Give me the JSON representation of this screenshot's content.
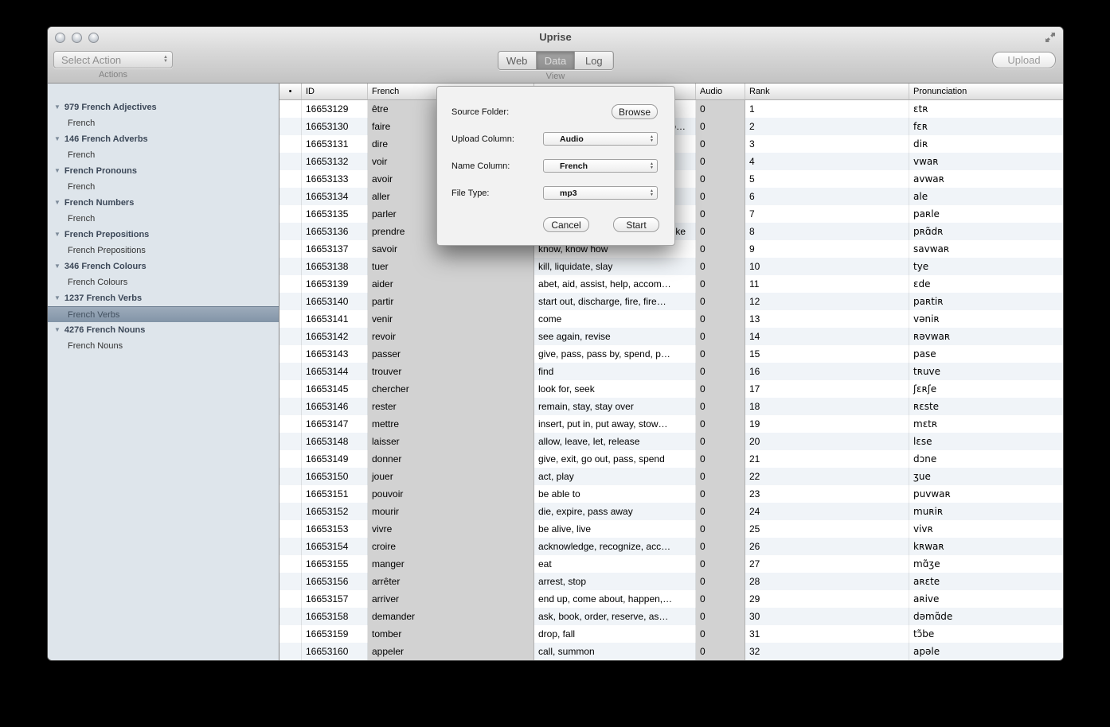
{
  "window": {
    "title": "Uprise"
  },
  "toolbar": {
    "action_select": {
      "value": "Select Action",
      "label": "Actions"
    },
    "view_segments": {
      "items": [
        "Web",
        "Data",
        "Log"
      ],
      "selected": "Data",
      "label": "View"
    },
    "upload_label": "Upload"
  },
  "sidebar": {
    "groups": [
      {
        "title": "979 French Adjectives",
        "items": [
          "French"
        ]
      },
      {
        "title": "146 French Adverbs",
        "items": [
          "French"
        ]
      },
      {
        "title": "French Pronouns",
        "items": [
          "French"
        ]
      },
      {
        "title": "French Numbers",
        "items": [
          "French"
        ]
      },
      {
        "title": "French Prepositions",
        "items": [
          "French Prepositions"
        ]
      },
      {
        "title": "346 French Colours",
        "items": [
          "French Colours"
        ]
      },
      {
        "title": "1237 French Verbs",
        "items": [
          "French Verbs"
        ],
        "selected": "French Verbs"
      },
      {
        "title": "4276 French Nouns",
        "items": [
          "French Nouns"
        ]
      }
    ]
  },
  "dialog": {
    "fields": [
      {
        "label": "Source Folder:",
        "type": "button",
        "value": "Browse"
      },
      {
        "label": "Upload Column:",
        "type": "select",
        "value": "Audio"
      },
      {
        "label": "Name Column:",
        "type": "select",
        "value": "French"
      },
      {
        "label": "File Type:",
        "type": "select",
        "value": "mp3"
      }
    ],
    "cancel_label": "Cancel",
    "start_label": "Start"
  },
  "table": {
    "columns": [
      "•",
      "ID",
      "French",
      "",
      "Audio",
      "Rank",
      "Pronunciation"
    ],
    "rows": [
      {
        "id": "16653129",
        "french": "être",
        "english": "",
        "audio": "0",
        "rank": "1",
        "pronunciation": "ɛtʀ"
      },
      {
        "id": "16653130",
        "french": "faire",
        "english": "o…",
        "english_partial": true,
        "audio": "0",
        "rank": "2",
        "pronunciation": "fɛʀ"
      },
      {
        "id": "16653131",
        "french": "dire",
        "english": "",
        "audio": "0",
        "rank": "3",
        "pronunciation": "diʀ"
      },
      {
        "id": "16653132",
        "french": "voir",
        "english": "",
        "audio": "0",
        "rank": "4",
        "pronunciation": "vwaʀ"
      },
      {
        "id": "16653133",
        "french": "avoir",
        "english": "",
        "audio": "0",
        "rank": "5",
        "pronunciation": "avwaʀ"
      },
      {
        "id": "16653134",
        "french": "aller",
        "english": "",
        "audio": "0",
        "rank": "6",
        "pronunciation": "ale"
      },
      {
        "id": "16653135",
        "french": "parler",
        "english": "",
        "audio": "0",
        "rank": "7",
        "pronunciation": "paʀle"
      },
      {
        "id": "16653136",
        "french": "prendre",
        "english": "ke",
        "english_partial": true,
        "audio": "0",
        "rank": "8",
        "pronunciation": "pʀɑ̃dʀ"
      },
      {
        "id": "16653137",
        "french": "savoir",
        "english": "know, know how",
        "audio": "0",
        "rank": "9",
        "pronunciation": "savwaʀ"
      },
      {
        "id": "16653138",
        "french": "tuer",
        "english": "kill, liquidate, slay",
        "audio": "0",
        "rank": "10",
        "pronunciation": "tye"
      },
      {
        "id": "16653139",
        "french": "aider",
        "english": "abet, aid, assist, help, accom…",
        "audio": "0",
        "rank": "11",
        "pronunciation": "ɛde"
      },
      {
        "id": "16653140",
        "french": "partir",
        "english": "start out, discharge, fire, fire…",
        "audio": "0",
        "rank": "12",
        "pronunciation": "paʀtiʀ"
      },
      {
        "id": "16653141",
        "french": "venir",
        "english": "come",
        "audio": "0",
        "rank": "13",
        "pronunciation": "vəniʀ"
      },
      {
        "id": "16653142",
        "french": "revoir",
        "english": "see again, revise",
        "audio": "0",
        "rank": "14",
        "pronunciation": "ʀəvwaʀ"
      },
      {
        "id": "16653143",
        "french": "passer",
        "english": "give, pass, pass by, spend, p…",
        "audio": "0",
        "rank": "15",
        "pronunciation": "pase"
      },
      {
        "id": "16653144",
        "french": "trouver",
        "english": "find",
        "audio": "0",
        "rank": "16",
        "pronunciation": "tʀuve"
      },
      {
        "id": "16653145",
        "french": "chercher",
        "english": "look for, seek",
        "audio": "0",
        "rank": "17",
        "pronunciation": "ʃɛʀʃe"
      },
      {
        "id": "16653146",
        "french": "rester",
        "english": "remain, stay, stay over",
        "audio": "0",
        "rank": "18",
        "pronunciation": "ʀɛste"
      },
      {
        "id": "16653147",
        "french": "mettre",
        "english": "insert, put in, put away, stow…",
        "audio": "0",
        "rank": "19",
        "pronunciation": "mɛtʀ"
      },
      {
        "id": "16653148",
        "french": "laisser",
        "english": "allow, leave, let, release",
        "audio": "0",
        "rank": "20",
        "pronunciation": "lɛse"
      },
      {
        "id": "16653149",
        "french": "donner",
        "english": "give, exit, go out, pass, spend",
        "audio": "0",
        "rank": "21",
        "pronunciation": "dɔne"
      },
      {
        "id": "16653150",
        "french": "jouer",
        "english": "act, play",
        "audio": "0",
        "rank": "22",
        "pronunciation": "ʒue"
      },
      {
        "id": "16653151",
        "french": "pouvoir",
        "english": "be able to",
        "audio": "0",
        "rank": "23",
        "pronunciation": "puvwaʀ"
      },
      {
        "id": "16653152",
        "french": "mourir",
        "english": "die, expire, pass away",
        "audio": "0",
        "rank": "24",
        "pronunciation": "muʀiʀ"
      },
      {
        "id": "16653153",
        "french": "vivre",
        "english": "be alive, live",
        "audio": "0",
        "rank": "25",
        "pronunciation": "vivʀ"
      },
      {
        "id": "16653154",
        "french": "croire",
        "english": "acknowledge, recognize, acc…",
        "audio": "0",
        "rank": "26",
        "pronunciation": "kʀwaʀ"
      },
      {
        "id": "16653155",
        "french": "manger",
        "english": "eat",
        "audio": "0",
        "rank": "27",
        "pronunciation": "mɑ̃ʒe"
      },
      {
        "id": "16653156",
        "french": "arrêter",
        "english": "arrest, stop",
        "audio": "0",
        "rank": "28",
        "pronunciation": "aʀɛte"
      },
      {
        "id": "16653157",
        "french": "arriver",
        "english": "end up, come about, happen,…",
        "audio": "0",
        "rank": "29",
        "pronunciation": "aʀive"
      },
      {
        "id": "16653158",
        "french": "demander",
        "english": "ask, book, order, reserve, as…",
        "audio": "0",
        "rank": "30",
        "pronunciation": "dəmɑ̃de"
      },
      {
        "id": "16653159",
        "french": "tomber",
        "english": "drop, fall",
        "audio": "0",
        "rank": "31",
        "pronunciation": "tɔ̃be"
      },
      {
        "id": "16653160",
        "french": "appeler",
        "english": "call, summon",
        "audio": "0",
        "rank": "32",
        "pronunciation": "apəle"
      }
    ]
  },
  "colors": {
    "highlight_column": "#d2d2d2",
    "row_stripe": "#f0f4f8",
    "sidebar_bg": "#dee5eb",
    "selected_item_top": "#9dabbb",
    "selected_item_bottom": "#8294a7"
  }
}
